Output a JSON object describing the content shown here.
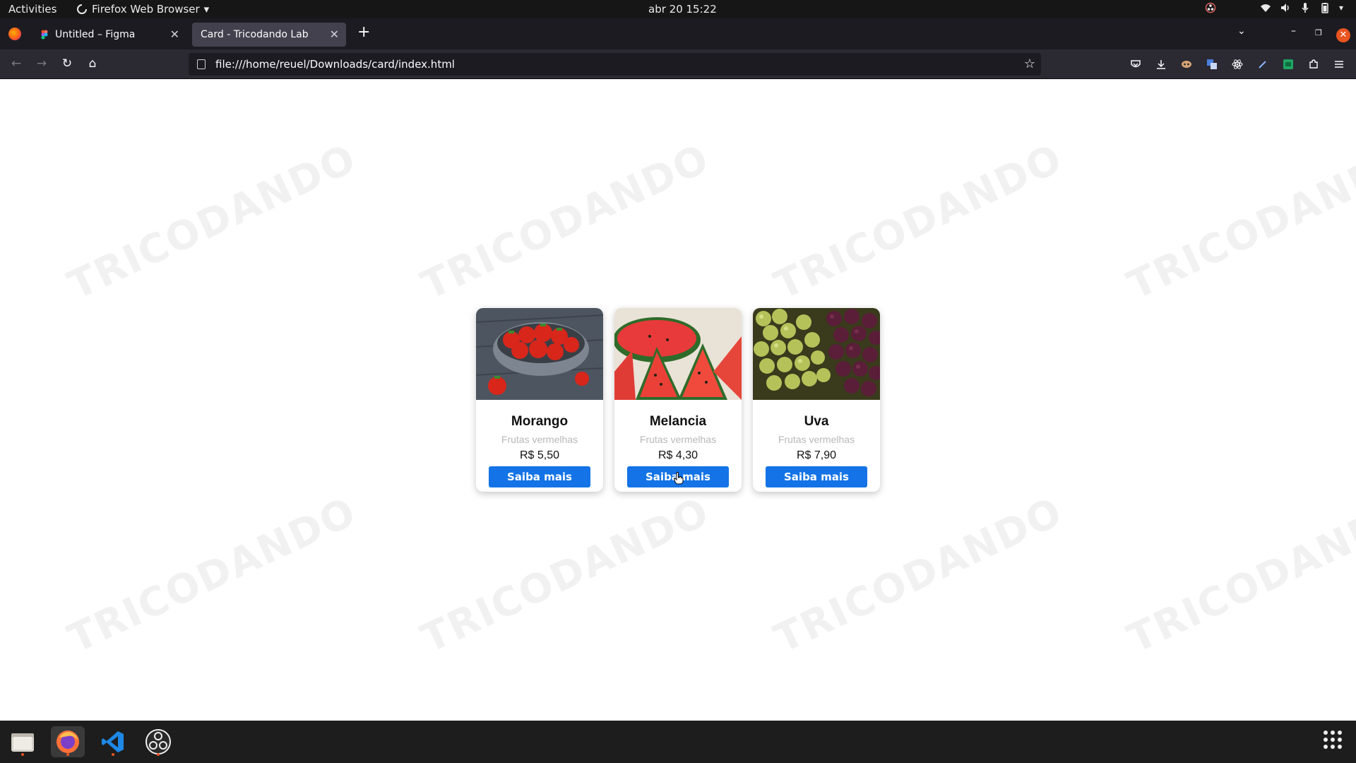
{
  "topbar": {
    "activities": "Activities",
    "app_name": "Firefox Web Browser",
    "clock": "abr 20  15:22"
  },
  "browser": {
    "tabs": [
      {
        "title": "Untitled – Figma",
        "active": false
      },
      {
        "title": "Card - Tricodando Lab",
        "active": true
      }
    ],
    "url": "file:///home/reuel/Downloads/card/index.html"
  },
  "page": {
    "watermark": "TRICODANDO",
    "cards": [
      {
        "name": "Morango",
        "category": "Frutas vermelhas",
        "price": "R$ 5,50",
        "button": "Saiba mais",
        "image": "strawberries-photo"
      },
      {
        "name": "Melancia",
        "category": "Frutas vermelhas",
        "price": "R$ 4,30",
        "button": "Saiba mais",
        "image": "watermelon-photo"
      },
      {
        "name": "Uva",
        "category": "Frutas vermelhas",
        "price": "R$ 7,90",
        "button": "Saiba mais",
        "image": "grapes-photo"
      }
    ]
  },
  "dock": {
    "apps": [
      "files-icon",
      "firefox-icon",
      "vscode-icon",
      "obs-icon"
    ]
  },
  "colors": {
    "button_blue": "#1473e6",
    "ubuntu_orange": "#e95420"
  }
}
